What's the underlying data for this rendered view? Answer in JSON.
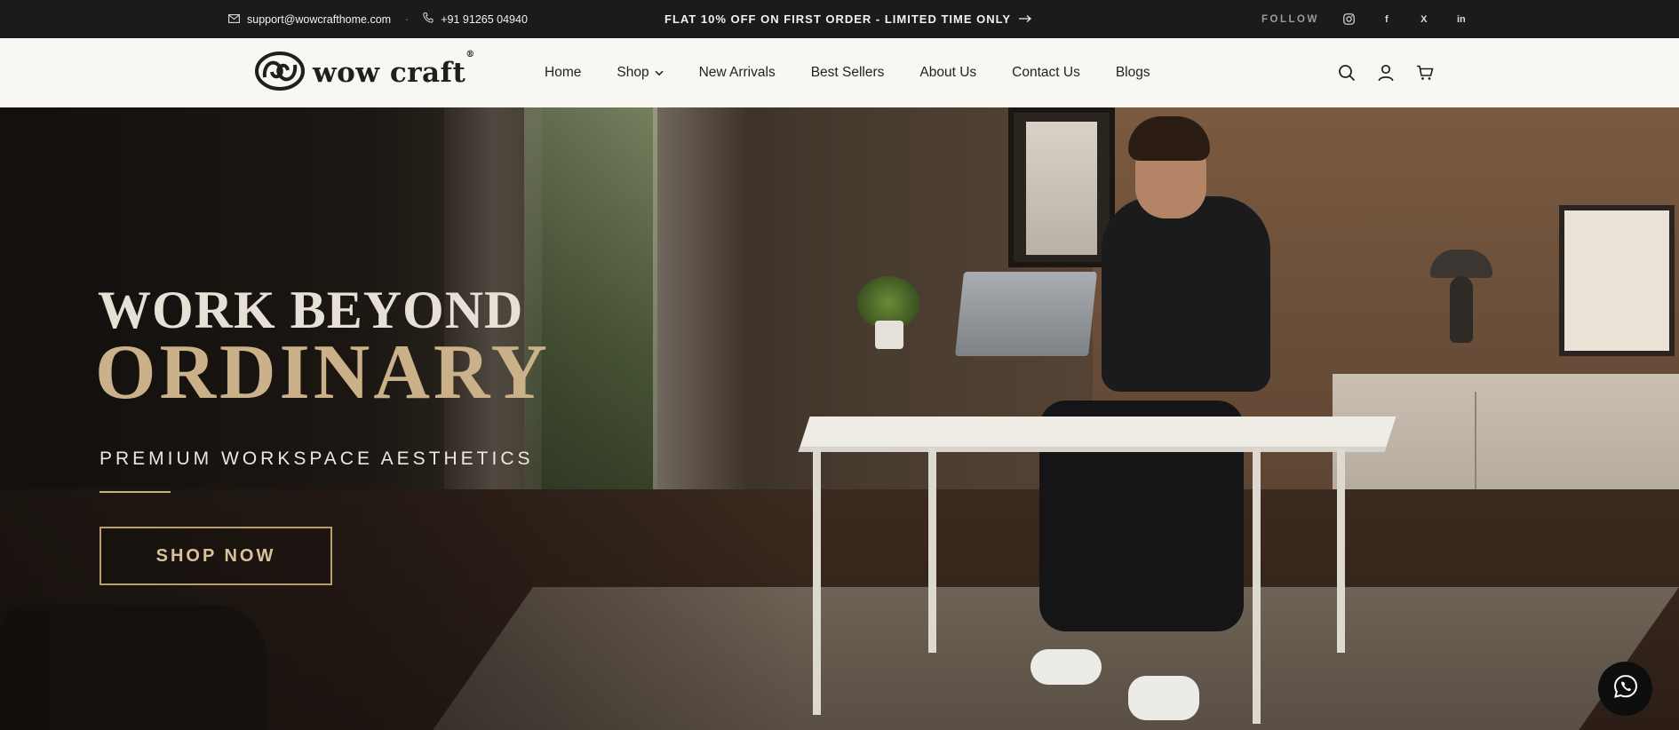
{
  "topbar": {
    "email": "support@wowcrafthome.com",
    "phone": "+91 91265 04940",
    "promo": "FLAT 10% OFF ON FIRST ORDER - LIMITED TIME ONLY",
    "follow_label": "FOLLOW",
    "social": {
      "facebook": "f",
      "x": "X",
      "linkedin": "in"
    }
  },
  "nav": {
    "logo_text": "wow craft",
    "logo_reg": "®",
    "items": [
      {
        "label": "Home"
      },
      {
        "label": "Shop"
      },
      {
        "label": "New Arrivals"
      },
      {
        "label": "Best Sellers"
      },
      {
        "label": "About Us"
      },
      {
        "label": "Contact Us"
      },
      {
        "label": "Blogs"
      }
    ]
  },
  "hero": {
    "headline_1": "WORK BEYOND",
    "headline_2": "ORDINARY",
    "subheadline": "PREMIUM WORKSPACE AESTHETICS",
    "cta": "SHOP NOW"
  },
  "colors": {
    "topbar_bg": "#1b1b1b",
    "nav_bg": "#f8f7f1",
    "accent_gold": "#cbb189",
    "whatsapp_bg": "#0d0d0d"
  },
  "icons": [
    "mail-icon",
    "phone-icon",
    "arrow-right-icon",
    "instagram-icon",
    "facebook-icon",
    "x-icon",
    "linkedin-icon",
    "chevron-down-icon",
    "search-icon",
    "user-icon",
    "cart-icon",
    "whatsapp-icon"
  ]
}
